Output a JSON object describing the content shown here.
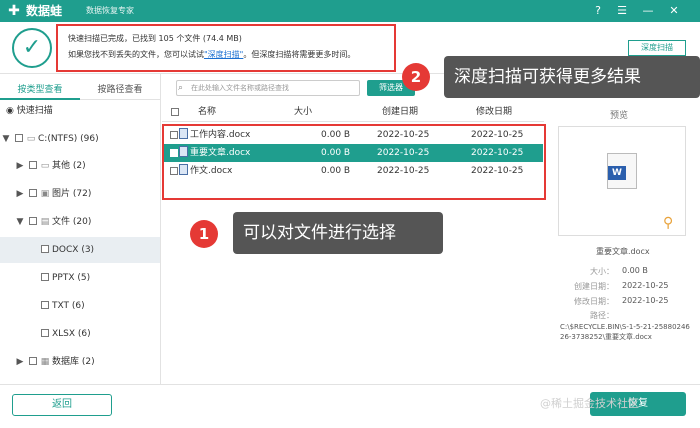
{
  "titlebar": {
    "logo_icon": "plus-logo-icon",
    "app_name": "数据蛙",
    "subtitle": "数据恢复专家"
  },
  "header": {
    "notice_line1": "快速扫描已完成，已找到 105 个文件 (74.4 MB)",
    "notice_pre": "如果您找不到丢失的文件，您可以试试",
    "deep_link": "\"深度扫描\"",
    "notice_post": "。但深度扫描将需要更多时间。",
    "deep_btn": "深度扫描"
  },
  "tabs": {
    "by_type": "按类型查看",
    "by_path": "按路径查看"
  },
  "sidebar": {
    "quick_scan": "快速扫描",
    "items": [
      {
        "label": "C:(NTFS) (96)",
        "arrow": "▼",
        "icon": "drive-icon"
      },
      {
        "label": "其他 (2)",
        "arrow": "▶",
        "icon": "folder-icon"
      },
      {
        "label": "图片 (72)",
        "arrow": "▶",
        "icon": "image-icon"
      },
      {
        "label": "文件 (20)",
        "arrow": "▼",
        "icon": "document-icon"
      },
      {
        "label": "DOCX (3)",
        "arrow": ""
      },
      {
        "label": "PPTX (5)",
        "arrow": ""
      },
      {
        "label": "TXT (6)",
        "arrow": ""
      },
      {
        "label": "XLSX (6)",
        "arrow": ""
      },
      {
        "label": "数据库 (2)",
        "arrow": "▶",
        "icon": "database-icon"
      }
    ]
  },
  "toolbar": {
    "search_placeholder": "在此处输入文件名称或路径查找",
    "filter_btn": "筛选器"
  },
  "table": {
    "headers": [
      "名称",
      "大小",
      "创建日期",
      "修改日期"
    ],
    "rows": [
      {
        "name": "工作内容.docx",
        "size": "0.00 B",
        "created": "2022-10-25",
        "modified": "2022-10-25"
      },
      {
        "name": "重要文章.docx",
        "size": "0.00 B",
        "created": "2022-10-25",
        "modified": "2022-10-25"
      },
      {
        "name": "作文.docx",
        "size": "0.00 B",
        "created": "2022-10-25",
        "modified": "2022-10-25"
      }
    ]
  },
  "preview": {
    "label": "预览",
    "file_name": "重要文章.docx",
    "size_label": "大小：",
    "size": "0.00 B",
    "created_label": "创建日期：",
    "created": "2022-10-25",
    "modified_label": "修改日期：",
    "modified": "2022-10-25",
    "path_label": "路径：",
    "path": "C:\\$RECYCLE.BIN\\S-1-5-21-2588024626-3738252\\重要文章.docx"
  },
  "footer": {
    "back": "返回",
    "recover": "恢复",
    "watermark": "@稀土掘金技术社区"
  },
  "callouts": [
    {
      "num": "1",
      "text": "可以对文件进行选择"
    },
    {
      "num": "2",
      "text": "深度扫描可获得更多结果"
    }
  ],
  "colors": {
    "accent": "#1f9e8e",
    "highlight": "#e53935",
    "callout_bg": "#555555"
  }
}
